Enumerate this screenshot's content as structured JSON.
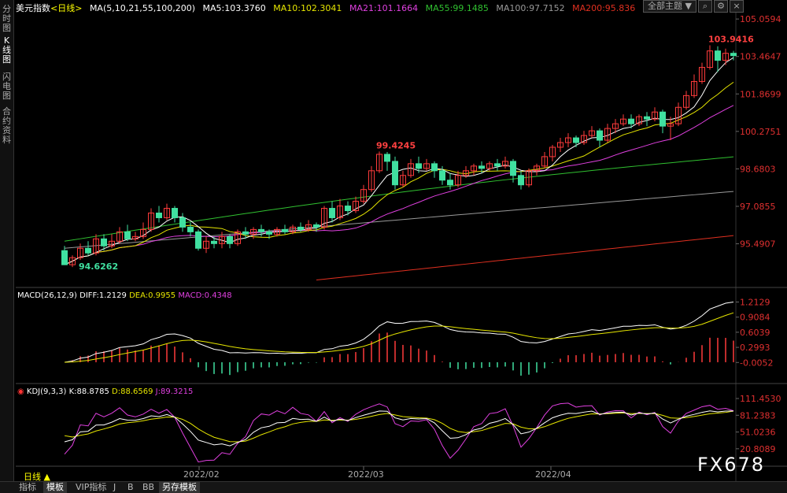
{
  "sidebar": {
    "tabs": [
      {
        "label": "分时图"
      },
      {
        "label": "K线图"
      },
      {
        "label": "闪电图"
      },
      {
        "label": "合约资料"
      }
    ]
  },
  "header": {
    "symbol": "美元指数",
    "period_tag": "<日线>",
    "ma_params": "MA(5,10,21,55,100,200)",
    "ma5": "MA5:103.3760",
    "ma10": "MA10:102.3041",
    "ma21": "MA21:101.1664",
    "ma55": "MA55:99.1485",
    "ma100": "MA100:97.7152",
    "ma200": "MA200:95.836",
    "theme_button": "全部主题",
    "theme_arrow": "▼"
  },
  "macd_header": {
    "name": "MACD(26,12,9)",
    "diff": "DIFF:1.2129",
    "dea": "DEA:0.9955",
    "macd": "MACD:0.4348"
  },
  "kdj_header": {
    "name": "KDJ(9,3,3)",
    "k": "K:88.8785",
    "d": "D:88.6569",
    "j": "J:89.3215"
  },
  "bottom": {
    "period": "日线 ▲",
    "tabs": [
      "指标",
      "模板",
      "VIP指标",
      "J",
      "B",
      "BB",
      "另存模板"
    ]
  },
  "watermark": "FX678",
  "colors": {
    "up": "#ff3b3b",
    "down": "#40e0a0",
    "ma5": "#ffffff",
    "ma10": "#e6e600",
    "ma21": "#e040e0",
    "ma55": "#30c030",
    "ma100": "#999999",
    "ma200": "#e03020"
  },
  "chart_data": [
    {
      "type": "candlestick",
      "title": "美元指数 日线",
      "y_ticks": [
        "105.0594",
        "103.4647",
        "101.8699",
        "100.2751",
        "98.6803",
        "97.0855",
        "95.4907"
      ],
      "ylim": [
        93.8,
        105.6
      ],
      "x_ticks": [
        "2022/02",
        "2022/03",
        "2022/04"
      ],
      "annotations": [
        {
          "label": "103.9416",
          "kind": "high"
        },
        {
          "label": "99.4245",
          "kind": "high"
        },
        {
          "label": "94.6262",
          "kind": "low"
        }
      ],
      "candles": [
        [
          95.2,
          94.6,
          95.4,
          94.6
        ],
        [
          94.6,
          94.9,
          95.0,
          94.5
        ],
        [
          94.9,
          95.3,
          95.5,
          94.8
        ],
        [
          95.3,
          95.1,
          95.6,
          95.0
        ],
        [
          95.1,
          95.7,
          95.9,
          95.0
        ],
        [
          95.7,
          95.4,
          95.9,
          95.2
        ],
        [
          95.4,
          95.6,
          95.9,
          95.3
        ],
        [
          95.6,
          96.0,
          96.2,
          95.5
        ],
        [
          96.0,
          95.7,
          96.3,
          95.6
        ],
        [
          95.7,
          95.8,
          96.0,
          95.6
        ],
        [
          95.8,
          96.1,
          96.4,
          95.7
        ],
        [
          96.1,
          96.8,
          97.0,
          96.0
        ],
        [
          96.8,
          96.6,
          97.1,
          96.4
        ],
        [
          96.6,
          97.0,
          97.2,
          96.5
        ],
        [
          97.0,
          96.6,
          97.1,
          96.4
        ],
        [
          96.6,
          96.2,
          96.8,
          96.0
        ],
        [
          96.2,
          96.0,
          96.4,
          95.8
        ],
        [
          96.0,
          95.3,
          96.1,
          95.2
        ],
        [
          95.3,
          95.6,
          95.8,
          95.1
        ],
        [
          95.6,
          95.5,
          95.8,
          95.3
        ],
        [
          95.5,
          95.8,
          96.0,
          95.3
        ],
        [
          95.8,
          95.5,
          95.9,
          95.3
        ],
        [
          95.5,
          96.0,
          96.1,
          95.4
        ],
        [
          96.0,
          95.9,
          96.2,
          95.7
        ],
        [
          95.9,
          96.1,
          96.2,
          95.7
        ],
        [
          96.1,
          96.0,
          96.3,
          95.8
        ],
        [
          96.0,
          95.9,
          96.1,
          95.7
        ],
        [
          95.9,
          96.1,
          96.2,
          95.8
        ],
        [
          96.1,
          96.0,
          96.3,
          95.9
        ],
        [
          96.0,
          96.2,
          96.3,
          95.9
        ],
        [
          96.2,
          96.1,
          96.4,
          96.0
        ],
        [
          96.1,
          96.3,
          96.5,
          96.0
        ],
        [
          96.3,
          96.2,
          96.4,
          96.0
        ],
        [
          96.2,
          97.0,
          97.1,
          96.1
        ],
        [
          97.0,
          96.6,
          97.3,
          96.4
        ],
        [
          96.6,
          97.1,
          97.4,
          96.5
        ],
        [
          97.1,
          96.9,
          97.3,
          96.7
        ],
        [
          96.9,
          97.3,
          97.5,
          96.8
        ],
        [
          97.3,
          97.8,
          98.0,
          97.2
        ],
        [
          97.8,
          98.6,
          98.8,
          97.7
        ],
        [
          98.6,
          99.3,
          99.42,
          98.5
        ],
        [
          99.3,
          99.0,
          99.4,
          98.6
        ],
        [
          99.0,
          98.0,
          99.2,
          97.8
        ],
        [
          98.0,
          98.4,
          98.6,
          97.9
        ],
        [
          98.4,
          98.9,
          99.1,
          98.3
        ],
        [
          98.9,
          98.7,
          99.2,
          98.5
        ],
        [
          98.7,
          98.9,
          99.1,
          98.6
        ],
        [
          98.9,
          98.6,
          99.0,
          98.3
        ],
        [
          98.6,
          98.2,
          98.8,
          98.0
        ],
        [
          98.2,
          98.0,
          98.5,
          97.8
        ],
        [
          98.0,
          98.4,
          98.6,
          97.9
        ],
        [
          98.4,
          98.6,
          98.8,
          98.3
        ],
        [
          98.6,
          98.8,
          98.9,
          98.4
        ],
        [
          98.8,
          98.7,
          99.0,
          98.5
        ],
        [
          98.7,
          98.9,
          99.0,
          98.6
        ],
        [
          98.9,
          98.8,
          99.1,
          98.6
        ],
        [
          98.8,
          99.0,
          99.2,
          98.7
        ],
        [
          99.0,
          98.4,
          99.1,
          98.1
        ],
        [
          98.4,
          98.0,
          98.6,
          97.8
        ],
        [
          98.0,
          98.6,
          98.7,
          97.9
        ],
        [
          98.6,
          98.8,
          98.9,
          98.4
        ],
        [
          98.8,
          99.2,
          99.4,
          98.7
        ],
        [
          99.2,
          99.6,
          99.7,
          99.0
        ],
        [
          99.6,
          99.8,
          100.0,
          99.4
        ],
        [
          99.8,
          100.0,
          100.2,
          99.6
        ],
        [
          100.0,
          99.8,
          100.1,
          99.6
        ],
        [
          99.8,
          100.1,
          100.3,
          99.7
        ],
        [
          100.1,
          100.3,
          100.5,
          100.0
        ],
        [
          100.3,
          99.9,
          100.4,
          99.6
        ],
        [
          99.9,
          100.4,
          100.6,
          99.8
        ],
        [
          100.4,
          100.6,
          100.8,
          100.2
        ],
        [
          100.6,
          100.8,
          101.0,
          100.5
        ],
        [
          100.8,
          100.6,
          101.0,
          100.4
        ],
        [
          100.6,
          100.9,
          101.0,
          100.5
        ],
        [
          100.9,
          100.8,
          101.1,
          100.5
        ],
        [
          100.8,
          101.1,
          101.3,
          100.7
        ],
        [
          101.1,
          100.5,
          101.2,
          100.2
        ],
        [
          100.5,
          100.6,
          100.9,
          99.9
        ],
        [
          100.6,
          101.3,
          101.5,
          100.5
        ],
        [
          101.3,
          101.8,
          102.0,
          101.2
        ],
        [
          101.8,
          102.4,
          102.7,
          101.7
        ],
        [
          102.4,
          103.0,
          103.2,
          102.3
        ],
        [
          103.0,
          103.7,
          103.94,
          102.9
        ],
        [
          103.7,
          103.3,
          103.9,
          102.8
        ],
        [
          103.3,
          103.6,
          103.8,
          103.1
        ],
        [
          103.6,
          103.5,
          103.7,
          103.3
        ]
      ]
    },
    {
      "type": "macd",
      "name": "MACD(26,12,9)",
      "y_ticks": [
        "1.2129",
        "0.9084",
        "0.6039",
        "0.2993",
        "-0.0052"
      ],
      "ylim": [
        -0.35,
        1.3
      ],
      "diff": 1.2129,
      "dea": 0.9955,
      "macd": 0.4348
    },
    {
      "type": "kdj",
      "name": "KDJ(9,3,3)",
      "y_ticks": [
        "111.4530",
        "81.2383",
        "51.0236",
        "20.8089"
      ],
      "ylim": [
        -5,
        120
      ],
      "k": 88.8785,
      "d": 88.6569,
      "j": 89.3215
    }
  ]
}
